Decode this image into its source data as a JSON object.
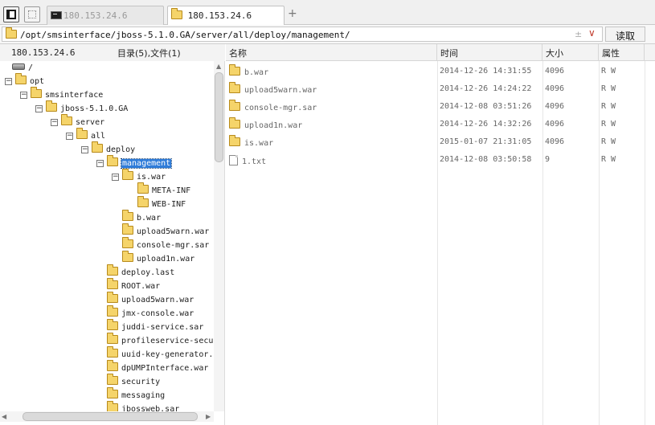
{
  "tabs": [
    {
      "label": "180.153.24.6",
      "type": "terminal",
      "active": false
    },
    {
      "label": "180.153.24.6",
      "type": "folder",
      "active": true
    }
  ],
  "tab_add_label": "+",
  "path": {
    "value": "/opt/smsinterface/jboss-5.1.0.GA/server/all/deploy/management/",
    "pin_glyph": "±",
    "dropdown_glyph": "∨",
    "read_button": "读取"
  },
  "left_panel": {
    "host": "180.153.24.6",
    "counts": "目录(5),文件(1)",
    "tree": [
      {
        "label": "/",
        "depth": 0,
        "icon": "drive-icon",
        "expander": ""
      },
      {
        "label": "opt",
        "depth": 0,
        "icon": "folder-icon",
        "expander": "−"
      },
      {
        "label": "smsinterface",
        "depth": 1,
        "icon": "folder-icon",
        "expander": "−"
      },
      {
        "label": "jboss-5.1.0.GA",
        "depth": 2,
        "icon": "folder-icon",
        "expander": "−"
      },
      {
        "label": "server",
        "depth": 3,
        "icon": "folder-icon",
        "expander": "−"
      },
      {
        "label": "all",
        "depth": 4,
        "icon": "folder-icon",
        "expander": "−"
      },
      {
        "label": "deploy",
        "depth": 5,
        "icon": "folder-icon",
        "expander": "−"
      },
      {
        "label": "management",
        "depth": 6,
        "icon": "folder-icon",
        "expander": "−",
        "selected": true
      },
      {
        "label": "is.war",
        "depth": 7,
        "icon": "folder-icon",
        "expander": "−"
      },
      {
        "label": "META-INF",
        "depth": 8,
        "icon": "folder-icon",
        "expander": ""
      },
      {
        "label": "WEB-INF",
        "depth": 8,
        "icon": "folder-icon",
        "expander": ""
      },
      {
        "label": "b.war",
        "depth": 7,
        "icon": "folder-icon",
        "expander": ""
      },
      {
        "label": "upload5warn.war",
        "depth": 7,
        "icon": "folder-icon",
        "expander": ""
      },
      {
        "label": "console-mgr.sar",
        "depth": 7,
        "icon": "folder-icon",
        "expander": ""
      },
      {
        "label": "upload1n.war",
        "depth": 7,
        "icon": "folder-icon",
        "expander": ""
      },
      {
        "label": "deploy.last",
        "depth": 6,
        "icon": "folder-icon",
        "expander": ""
      },
      {
        "label": "ROOT.war",
        "depth": 6,
        "icon": "folder-icon",
        "expander": ""
      },
      {
        "label": "upload5warn.war",
        "depth": 6,
        "icon": "folder-icon",
        "expander": ""
      },
      {
        "label": "jmx-console.war",
        "depth": 6,
        "icon": "folder-icon",
        "expander": ""
      },
      {
        "label": "juddi-service.sar",
        "depth": 6,
        "icon": "folder-icon",
        "expander": ""
      },
      {
        "label": "profileservice-secu",
        "depth": 6,
        "icon": "folder-icon",
        "expander": ""
      },
      {
        "label": "uuid-key-generator.",
        "depth": 6,
        "icon": "folder-icon",
        "expander": ""
      },
      {
        "label": "dpUMPInterface.war",
        "depth": 6,
        "icon": "folder-icon",
        "expander": ""
      },
      {
        "label": "security",
        "depth": 6,
        "icon": "folder-icon",
        "expander": ""
      },
      {
        "label": "messaging",
        "depth": 6,
        "icon": "folder-icon",
        "expander": ""
      },
      {
        "label": "jbossweb.sar",
        "depth": 6,
        "icon": "folder-icon",
        "expander": ""
      }
    ]
  },
  "file_list": {
    "columns": {
      "name": "名称",
      "time": "时间",
      "size": "大小",
      "attr": "属性"
    },
    "rows": [
      {
        "name": "b.war",
        "icon": "folder-icon",
        "time": "2014-12-26 14:31:55",
        "size": "4096",
        "attr": "R W"
      },
      {
        "name": "upload5warn.war",
        "icon": "folder-icon",
        "time": "2014-12-26 14:24:22",
        "size": "4096",
        "attr": "R W"
      },
      {
        "name": "console-mgr.sar",
        "icon": "folder-icon",
        "time": "2014-12-08 03:51:26",
        "size": "4096",
        "attr": "R W"
      },
      {
        "name": "upload1n.war",
        "icon": "folder-icon",
        "time": "2014-12-26 14:32:26",
        "size": "4096",
        "attr": "R W"
      },
      {
        "name": "is.war",
        "icon": "folder-icon",
        "time": "2015-01-07 21:31:05",
        "size": "4096",
        "attr": "R W"
      },
      {
        "name": "1.txt",
        "icon": "file-icon",
        "time": "2014-12-08 03:50:58",
        "size": "9",
        "attr": "R W"
      }
    ]
  },
  "colors": {
    "selection": "#2f7cd9",
    "folder": "#f5d46a",
    "accent": "#c0392b"
  }
}
